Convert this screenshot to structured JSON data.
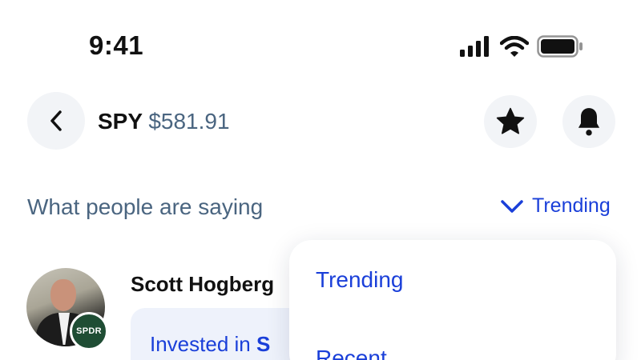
{
  "status_bar": {
    "time": "9:41",
    "icons": [
      "cellular-signal-icon",
      "wifi-icon",
      "battery-icon"
    ]
  },
  "header": {
    "back_icon": "chevron-left-icon",
    "ticker": "SPY",
    "price": "$581.91",
    "star_icon": "star-icon",
    "bell_icon": "bell-icon"
  },
  "discussion": {
    "section_title": "What people are saying",
    "sort_label": "Trending",
    "sort_icon": "chevron-down-icon"
  },
  "post": {
    "author": "Scott Hogberg",
    "badge": "SPDR",
    "text_prefix": "Invested in",
    "text_highlight": "S"
  },
  "sort_menu": {
    "options": [
      "Trending",
      "Recent"
    ]
  },
  "colors": {
    "accent": "#1a3fd9",
    "muted_text": "#4a6580",
    "badge_green": "#1f4d34"
  }
}
